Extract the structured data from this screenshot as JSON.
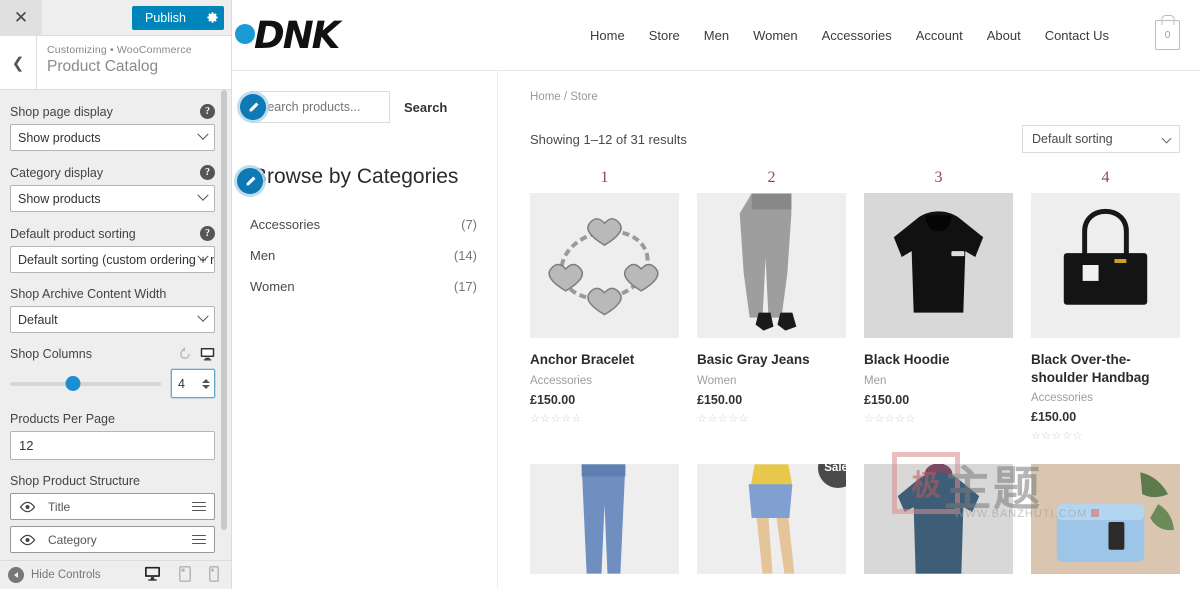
{
  "customizer": {
    "close_label": "✕",
    "publish_label": "Publish",
    "gear_icon": "gear-icon",
    "back_icon": "chevron-left-icon",
    "breadcrumb_prefix": "Customizing",
    "breadcrumb_section": "WooCommerce",
    "page_title": "Product Catalog",
    "controls": [
      {
        "label": "Shop page display",
        "help": "?",
        "type": "select",
        "value": "Show products"
      },
      {
        "label": "Category display",
        "help": "?",
        "type": "select",
        "value": "Show products"
      },
      {
        "label": "Default product sorting",
        "help": "?",
        "type": "select",
        "value": "Default sorting (custom ordering + na"
      },
      {
        "label": "Shop Archive Content Width",
        "help": "",
        "type": "select",
        "value": "Default"
      }
    ],
    "shop_columns": {
      "label": "Shop Columns",
      "value": "4",
      "percent": 42,
      "reset_icon": "reset-icon",
      "device_icon": "desktop-icon"
    },
    "products_per_page": {
      "label": "Products Per Page",
      "value": "12"
    },
    "product_structure": {
      "label": "Shop Product Structure",
      "items": [
        {
          "label": "Title",
          "eye_icon": "eye-icon",
          "grip_icon": "drag-handle-icon"
        },
        {
          "label": "Category",
          "eye_icon": "eye-icon",
          "grip_icon": "drag-handle-icon"
        }
      ]
    },
    "footer": {
      "hide_controls_label": "Hide Controls",
      "devices": [
        {
          "name": "desktop",
          "icon": "desktop-icon",
          "active": true
        },
        {
          "name": "tablet",
          "icon": "tablet-icon",
          "active": false
        },
        {
          "name": "mobile",
          "icon": "mobile-icon",
          "active": false
        }
      ]
    }
  },
  "site": {
    "logo_text": "DNK",
    "nav": [
      {
        "label": "Home"
      },
      {
        "label": "Store"
      },
      {
        "label": "Men"
      },
      {
        "label": "Women"
      },
      {
        "label": "Accessories"
      },
      {
        "label": "Account"
      },
      {
        "label": "About"
      },
      {
        "label": "Contact Us"
      }
    ],
    "cart_count": "0",
    "search": {
      "placeholder": "Search products...",
      "value": "",
      "button_label": "Search"
    },
    "categories_title": "Browse by Categories",
    "categories": [
      {
        "label": "Accessories",
        "count": "(7)"
      },
      {
        "label": "Men",
        "count": "(14)"
      },
      {
        "label": "Women",
        "count": "(17)"
      }
    ],
    "breadcrumb": "Home / Store",
    "result_count": "Showing 1–12 of 31 results",
    "sorting_value": "Default sorting",
    "products": [
      {
        "number": "1",
        "title": "Anchor Bracelet",
        "category": "Accessories",
        "price": "£150.00",
        "stars": "☆☆☆☆☆",
        "sale": false
      },
      {
        "number": "2",
        "title": "Basic Gray Jeans",
        "category": "Women",
        "price": "£150.00",
        "stars": "☆☆☆☆☆",
        "sale": false
      },
      {
        "number": "3",
        "title": "Black Hoodie",
        "category": "Men",
        "price": "£150.00",
        "stars": "☆☆☆☆☆",
        "sale": false
      },
      {
        "number": "4",
        "title": "Black Over-the-shoulder Handbag",
        "category": "Accessories",
        "price": "£150.00",
        "stars": "☆☆☆☆☆",
        "sale": false
      }
    ],
    "products_row2": [
      {
        "sale_label": "",
        "sale": false
      },
      {
        "sale_label": "Sale!",
        "sale": true
      },
      {
        "sale_label": "",
        "sale": false
      },
      {
        "sale_label": "",
        "sale": false
      }
    ]
  },
  "watermark": {
    "seal": "极",
    "big": "主题",
    "url": "WWW.BANZHUTI.COM"
  },
  "colors": {
    "accent": "#0085ba",
    "slider": "#1c8fd0",
    "number": "#8d4a4a",
    "sale_bg": "#4a4a4a"
  }
}
